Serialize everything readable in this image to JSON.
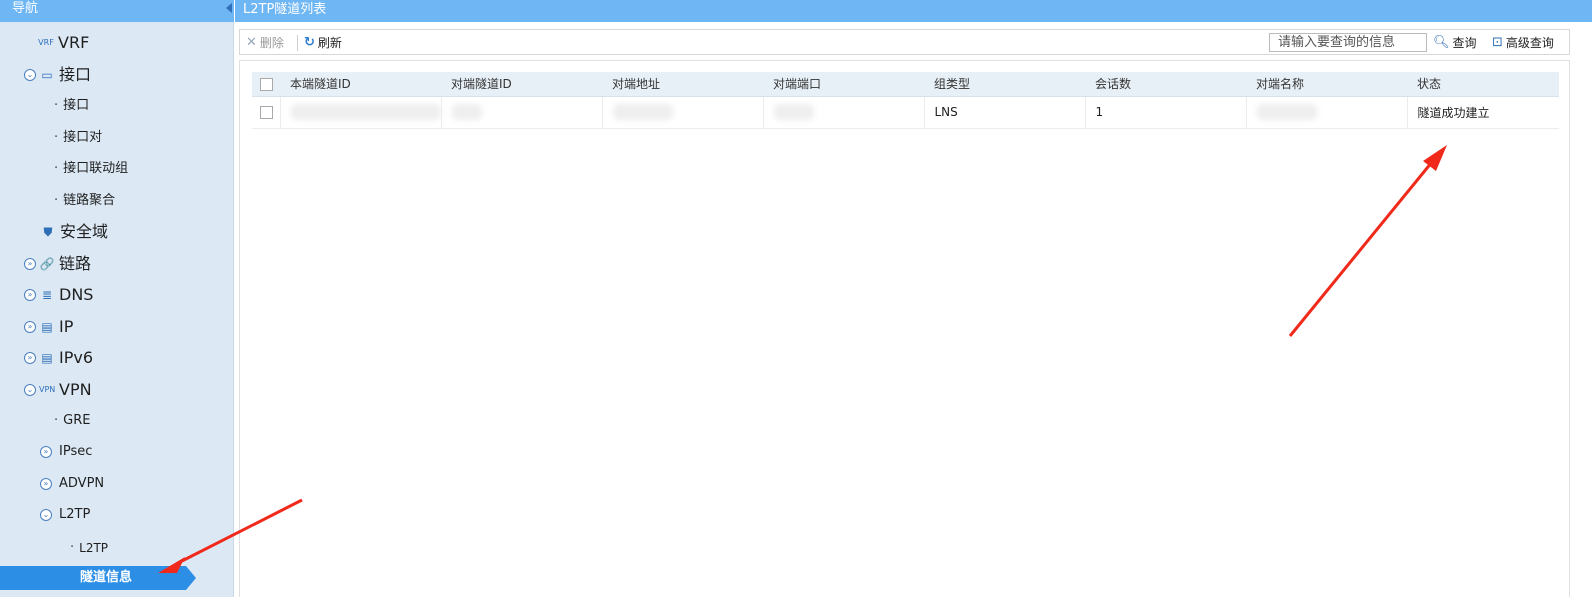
{
  "sidebar": {
    "title": "导航",
    "items": [
      {
        "label": "VRF",
        "icon": "vrf-icon"
      },
      {
        "label": "接口",
        "icon": "interface-icon"
      },
      {
        "label": "接口"
      },
      {
        "label": "接口对"
      },
      {
        "label": "接口联动组"
      },
      {
        "label": "链路聚合"
      },
      {
        "label": "安全域",
        "icon": "shield-icon"
      },
      {
        "label": "链路",
        "icon": "link-icon"
      },
      {
        "label": "DNS",
        "icon": "database-icon"
      },
      {
        "label": "IP",
        "icon": "ip-icon"
      },
      {
        "label": "IPv6",
        "icon": "ipv6-icon"
      },
      {
        "label": "VPN",
        "icon": "vpn-icon"
      },
      {
        "label": "GRE"
      },
      {
        "label": "IPsec"
      },
      {
        "label": "ADVPN"
      },
      {
        "label": "L2TP"
      },
      {
        "label": "L2TP"
      }
    ],
    "active_item": "隧道信息"
  },
  "main": {
    "title": "L2TP隧道列表"
  },
  "toolbar": {
    "delete_label": "删除",
    "refresh_label": "刷新",
    "search_placeholder": "请输入要查询的信息",
    "query_label": "查询",
    "advanced_query_label": "高级查询"
  },
  "table": {
    "columns": [
      "本端隧道ID",
      "对端隧道ID",
      "对端地址",
      "对端端口",
      "组类型",
      "会话数",
      "对端名称",
      "状态"
    ],
    "rows": [
      {
        "group_type": "LNS",
        "sessions": "1",
        "status": "隧道成功建立"
      }
    ]
  },
  "colors": {
    "header_bar": "#6fb6f4",
    "sidebar_bg": "#dce9f5",
    "active_item": "#2d8ee6",
    "annotation_arrow": "#f0291b"
  }
}
